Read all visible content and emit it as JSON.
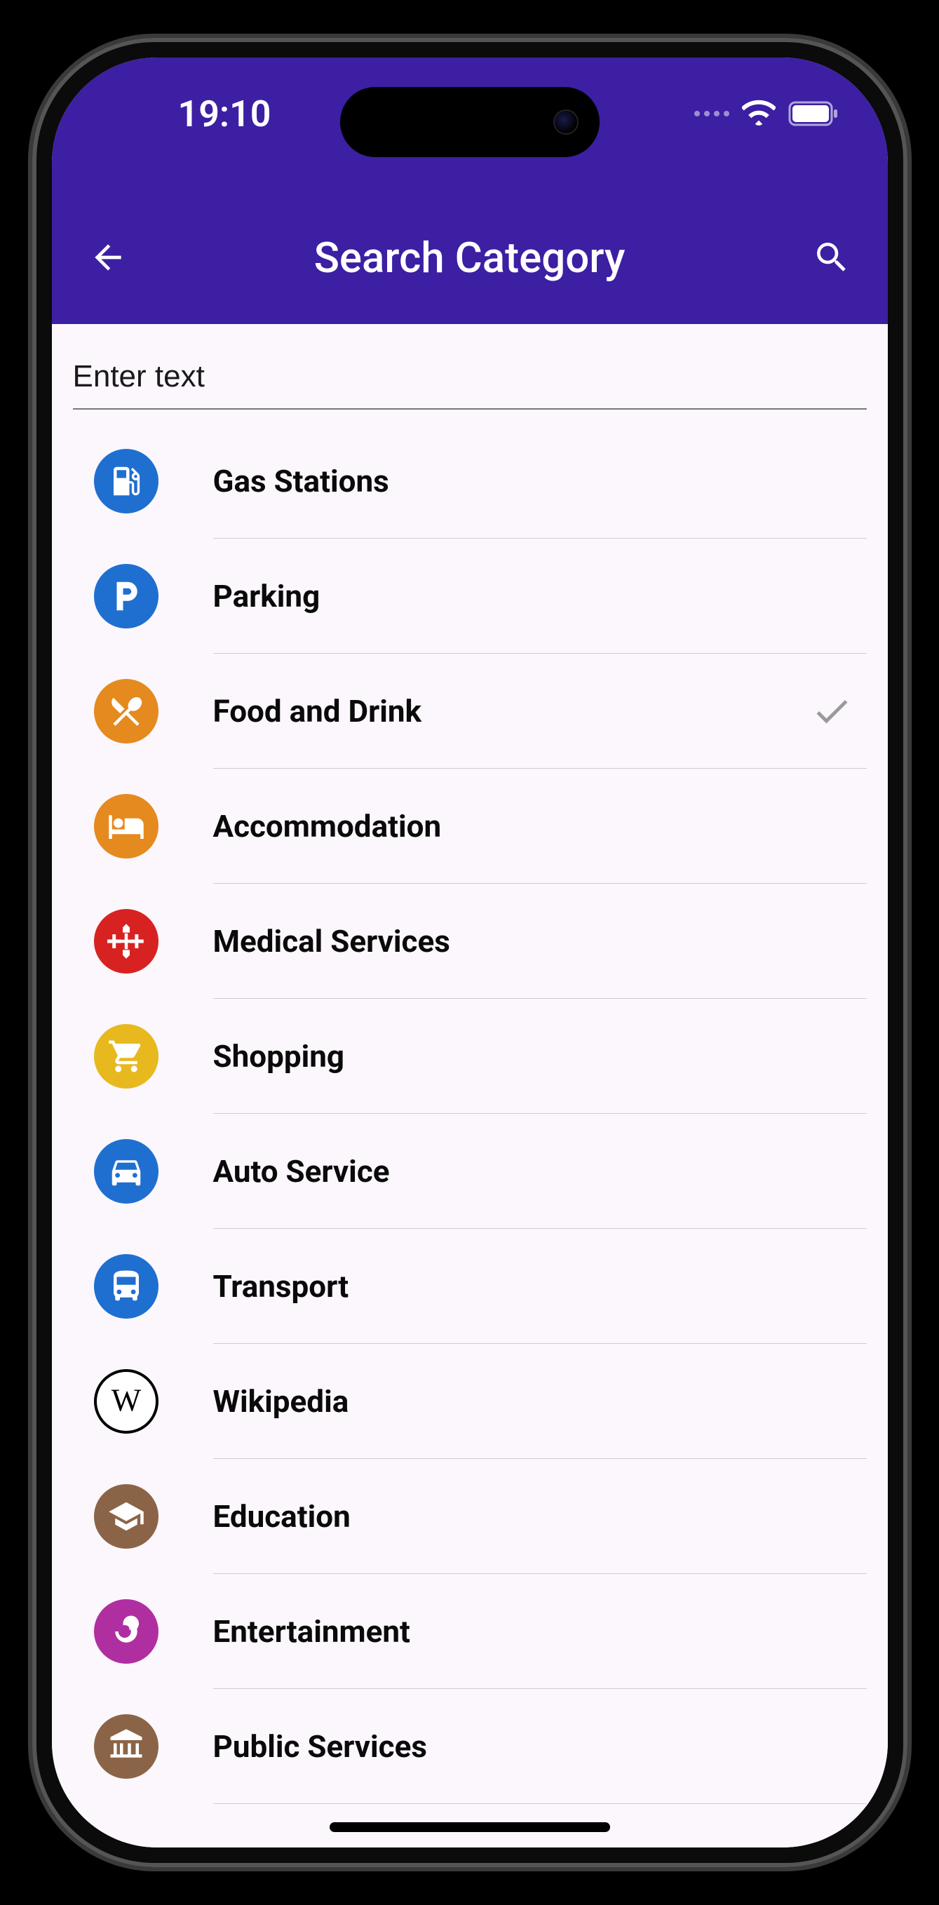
{
  "status": {
    "time": "19:10"
  },
  "header": {
    "title": "Search Category"
  },
  "search": {
    "placeholder": "Enter text",
    "value": ""
  },
  "categories": [
    {
      "id": "gas",
      "label": "Gas Stations",
      "icon": "gas-pump-icon",
      "color": "#1f6fd1",
      "selected": false
    },
    {
      "id": "parking",
      "label": "Parking",
      "icon": "parking-icon",
      "color": "#1f6fd1",
      "selected": false
    },
    {
      "id": "food",
      "label": "Food and Drink",
      "icon": "food-icon",
      "color": "#e58a1f",
      "selected": true
    },
    {
      "id": "accommodation",
      "label": "Accommodation",
      "icon": "bed-icon",
      "color": "#e58a1f",
      "selected": false
    },
    {
      "id": "medical",
      "label": "Medical Services",
      "icon": "medical-icon",
      "color": "#d82222",
      "selected": false
    },
    {
      "id": "shopping",
      "label": "Shopping",
      "icon": "cart-icon",
      "color": "#e8b81f",
      "selected": false
    },
    {
      "id": "auto",
      "label": "Auto Service",
      "icon": "car-icon",
      "color": "#1f6fd1",
      "selected": false
    },
    {
      "id": "transport",
      "label": "Transport",
      "icon": "bus-icon",
      "color": "#1f6fd1",
      "selected": false
    },
    {
      "id": "wikipedia",
      "label": "Wikipedia",
      "icon": "wikipedia-icon",
      "color": "#ffffff",
      "selected": false,
      "outline": true
    },
    {
      "id": "education",
      "label": "Education",
      "icon": "graduation-icon",
      "color": "#8b6447",
      "selected": false
    },
    {
      "id": "entertainment",
      "label": "Entertainment",
      "icon": "spiral-icon",
      "color": "#b02fa0",
      "selected": false
    },
    {
      "id": "public",
      "label": "Public Services",
      "icon": "bank-icon",
      "color": "#8b6447",
      "selected": false
    }
  ]
}
